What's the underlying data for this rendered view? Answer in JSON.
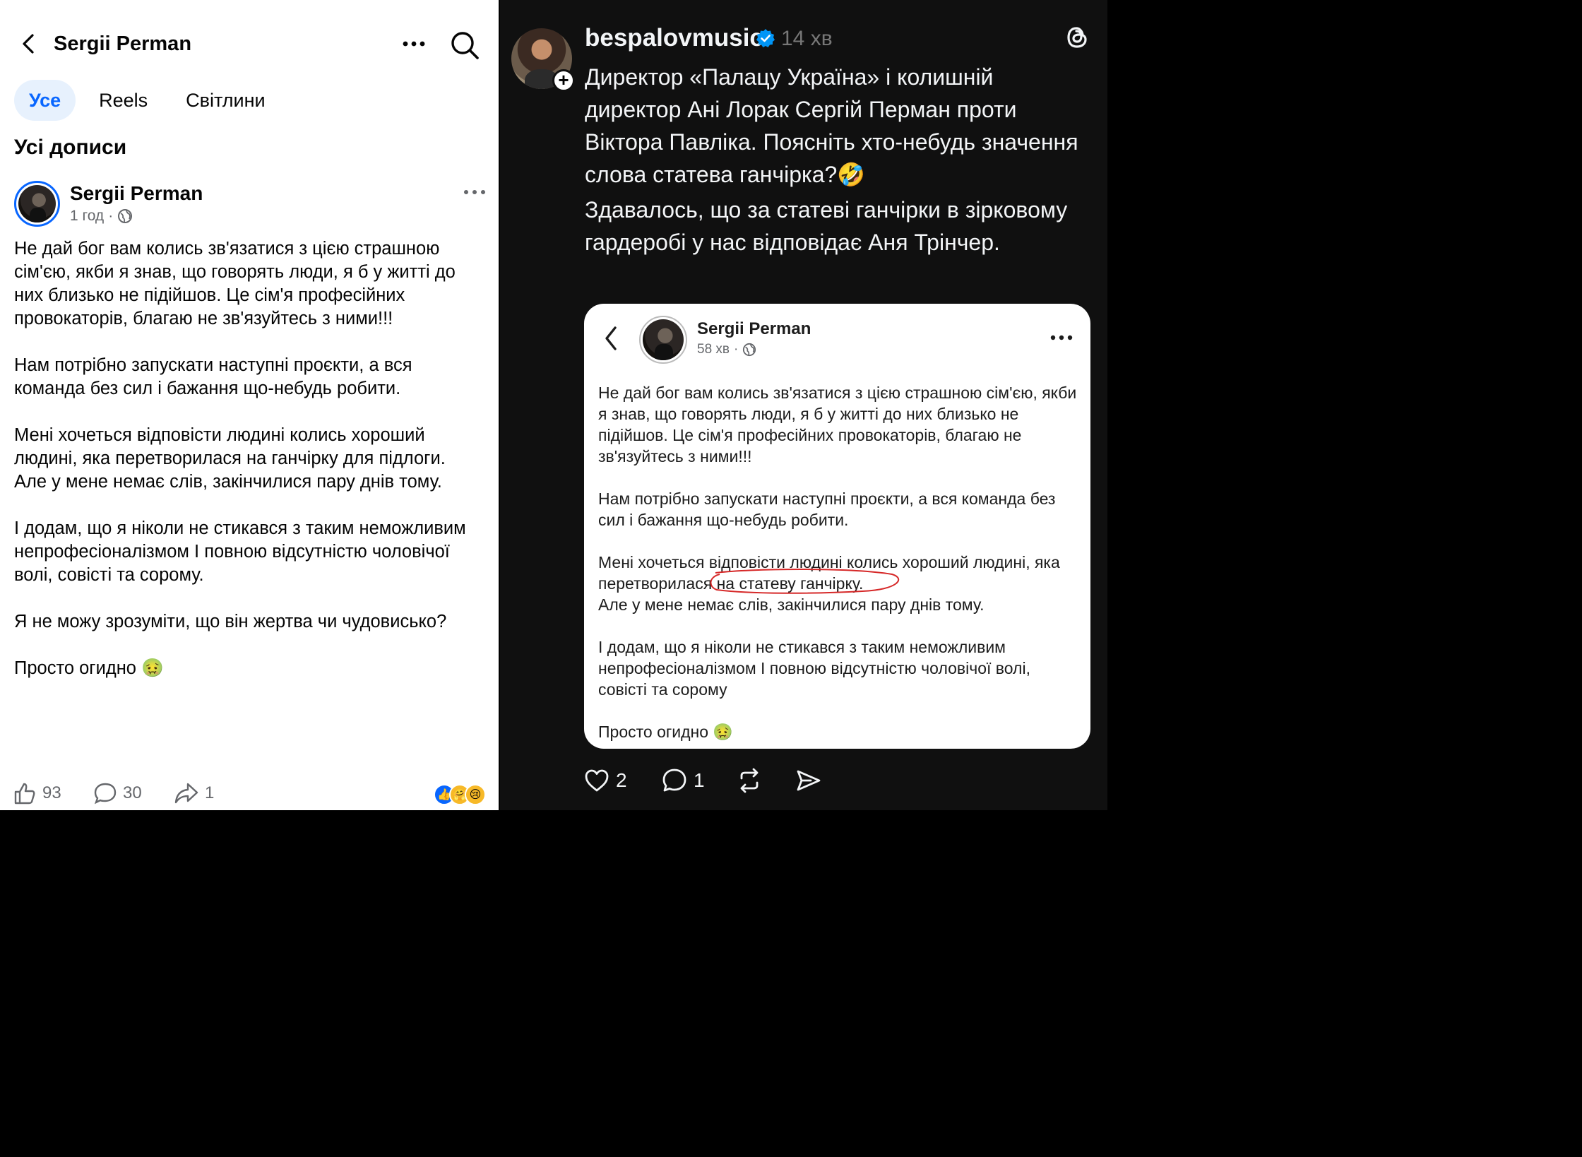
{
  "facebook": {
    "header": {
      "title": "Sergii Perman"
    },
    "tabs": [
      {
        "label": "Усе",
        "active": true
      },
      {
        "label": "Reels",
        "active": false
      },
      {
        "label": "Світлини",
        "active": false
      }
    ],
    "section_title": "Усі дописи",
    "post": {
      "author": "Sergii Perman",
      "time": "1 год",
      "paragraphs": [
        "Не дай бог вам колись зв'язатися з цією страшною сім'єю, якби я знав, що говорять люди, я б у житті до них близько не підійшов. Це сім'я професійних провокаторів, благаю не зв'язуйтесь з ними!!!",
        "Нам потрібно запускати наступні проєкти, а вся команда без сил і бажання що-небудь робити.",
        "Мені хочеться відповісти людині колись хороший людині, яка перетворилася на ганчірку для підлоги.",
        "Але у мене немає слів, закінчилися пару днів тому.",
        "І додам, що я ніколи не стикався з таким неможливим непрофесіоналізмом І повною відсутністю чоловічої волі, совісті та сорому.",
        "Я не можу зрозуміти, що він жертва чи чудовисько?",
        "Просто огидно 🤢"
      ],
      "likes": "93",
      "comments": "30",
      "shares": "1"
    },
    "accent_color": "#0866ff"
  },
  "threads": {
    "username": "bespalovmusic",
    "time": "14 хв",
    "text_p1": "Директор «Палацу Україна» і колишній директор Ані Лорак Сергій Перман проти Віктора Павліка. Поясніть хто-небудь значення слова статева ганчірка?🤣",
    "text_p2": "Здавалось, що за статеві ганчірки в зірковому гардеробі у нас відповідає Аня Трінчер.",
    "quoted": {
      "author": "Sergii Perman",
      "time": "58 хв",
      "p1": "Не дай бог вам колись зв'язатися з цією страшною сім'єю, якби я знав, що говорять люди, я б у житті до них близько не підійшов. Це сім'я професійних провокаторів, благаю не зв'язуйтесь з ними!!!",
      "p2": "Нам потрібно запускати наступні проєкти, а вся команда без сил і бажання що-небудь робити.",
      "p3_before": "Мені хочеться відповісти людині колись хороший людині, яка перетворилася ",
      "p3_circled": "на статеву ганчірку.",
      "p3_after": "Але у мене немає слів, закінчилися пару днів тому.",
      "p4": "І додам, що я ніколи не стикався з таким неможливим непрофесіоналізмом І повною відсутністю чоловічої волі, совісті та сорому",
      "p5": "Просто огидно 🤢"
    },
    "likes": "2",
    "replies": "1",
    "verified_color": "#0095f6",
    "highlight_color": "#d62828"
  }
}
